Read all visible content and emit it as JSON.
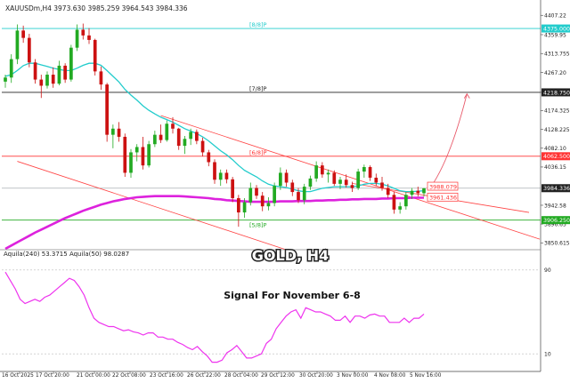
{
  "header": {
    "symbol_line": "XAUUSDm,H4  3973.630  3985.259  3964.543  3984.336",
    "indicator_line": "Aquila(240) 53.3715  Aquila(50) 98.0287"
  },
  "overlay": {
    "title": "GOLD, H4",
    "subtitle": "Signal For November 6-8"
  },
  "colors": {
    "bull": "#22aa22",
    "bear": "#cc1111",
    "ma_fast": "#22cccc",
    "ma_slow": "#dd22dd",
    "channel": "#ff4444",
    "level_cyan": "#22cccc",
    "level_red": "#ff3333",
    "level_green": "#22aa22",
    "level_black": "#222222",
    "oscillator": "#ee33ee"
  },
  "chart_data": [
    {
      "type": "candlestick",
      "title": "GOLD, H4",
      "symbol": "XAUUSDm",
      "timeframe": "H4",
      "ohlc_header": {
        "open": 3973.63,
        "high": 3985.259,
        "low": 3964.543,
        "close": 3984.336
      },
      "y_ticks": [
        4407.22,
        4359.95,
        4313.755,
        4267.2,
        4218.75,
        4174.325,
        4128.225,
        4082.1,
        4036.15,
        3942.58,
        3896.65,
        3850.615
      ],
      "x_ticks": [
        "16 Oct 2025",
        "17 Oct 20:00",
        "21 Oct 00:00",
        "22 Oct 08:00",
        "23 Oct 16:00",
        "26 Oct 22:00",
        "28 Oct 04:00",
        "29 Oct 12:00",
        "30 Oct 20:00",
        "3 Nov 00:00",
        "4 Nov 08:00",
        "5 Nov 16:00"
      ],
      "ylim": [
        3836,
        4436
      ],
      "price_labels": [
        {
          "label": "4375.000",
          "value": 4375.0,
          "kind": "cyan"
        },
        {
          "label": "4218.750",
          "value": 4218.75,
          "kind": "black"
        },
        {
          "label": "4062.500",
          "value": 4062.5,
          "kind": "red"
        },
        {
          "label": "3988.079",
          "value": 3988.079,
          "kind": "red-box"
        },
        {
          "label": "3984.336",
          "value": 3984.336,
          "kind": "current"
        },
        {
          "label": "3961.436",
          "value": 3961.436,
          "kind": "red-box"
        },
        {
          "label": "3906.250",
          "value": 3906.25,
          "kind": "green"
        }
      ],
      "levels": [
        {
          "label": "[8/8]P",
          "value": 4375.0,
          "kind": "cyan"
        },
        {
          "label": "[7/8]P",
          "value": 4218.75,
          "kind": "black"
        },
        {
          "label": "[6/8]P",
          "value": 4062.5,
          "kind": "red"
        },
        {
          "label": "[5/8]P",
          "value": 3906.25,
          "kind": "green"
        }
      ],
      "candles": [
        {
          "o": 4245,
          "h": 4262,
          "l": 4230,
          "c": 4255
        },
        {
          "o": 4255,
          "h": 4312,
          "l": 4242,
          "c": 4300
        },
        {
          "o": 4300,
          "h": 4385,
          "l": 4288,
          "c": 4370
        },
        {
          "o": 4370,
          "h": 4382,
          "l": 4340,
          "c": 4352
        },
        {
          "o": 4352,
          "h": 4362,
          "l": 4280,
          "c": 4292
        },
        {
          "o": 4292,
          "h": 4300,
          "l": 4240,
          "c": 4250
        },
        {
          "o": 4250,
          "h": 4262,
          "l": 4205,
          "c": 4235
        },
        {
          "o": 4235,
          "h": 4270,
          "l": 4228,
          "c": 4262
        },
        {
          "o": 4262,
          "h": 4280,
          "l": 4230,
          "c": 4240
        },
        {
          "o": 4240,
          "h": 4296,
          "l": 4236,
          "c": 4284
        },
        {
          "o": 4284,
          "h": 4290,
          "l": 4242,
          "c": 4250
        },
        {
          "o": 4250,
          "h": 4335,
          "l": 4245,
          "c": 4328
        },
        {
          "o": 4328,
          "h": 4385,
          "l": 4320,
          "c": 4372
        },
        {
          "o": 4372,
          "h": 4387,
          "l": 4348,
          "c": 4358
        },
        {
          "o": 4358,
          "h": 4376,
          "l": 4337,
          "c": 4347
        },
        {
          "o": 4347,
          "h": 4350,
          "l": 4260,
          "c": 4270
        },
        {
          "o": 4270,
          "h": 4282,
          "l": 4225,
          "c": 4238
        },
        {
          "o": 4238,
          "h": 4242,
          "l": 4098,
          "c": 4115
        },
        {
          "o": 4115,
          "h": 4140,
          "l": 4082,
          "c": 4130
        },
        {
          "o": 4130,
          "h": 4146,
          "l": 4098,
          "c": 4110
        },
        {
          "o": 4110,
          "h": 4118,
          "l": 4012,
          "c": 4022
        },
        {
          "o": 4022,
          "h": 4080,
          "l": 4010,
          "c": 4072
        },
        {
          "o": 4072,
          "h": 4092,
          "l": 4050,
          "c": 4085
        },
        {
          "o": 4085,
          "h": 4110,
          "l": 4030,
          "c": 4040
        },
        {
          "o": 4040,
          "h": 4100,
          "l": 4035,
          "c": 4092
        },
        {
          "o": 4092,
          "h": 4125,
          "l": 4085,
          "c": 4115
        },
        {
          "o": 4115,
          "h": 4140,
          "l": 4095,
          "c": 4102
        },
        {
          "o": 4102,
          "h": 4150,
          "l": 4098,
          "c": 4142
        },
        {
          "o": 4142,
          "h": 4158,
          "l": 4118,
          "c": 4130
        },
        {
          "o": 4130,
          "h": 4132,
          "l": 4078,
          "c": 4088
        },
        {
          "o": 4088,
          "h": 4112,
          "l": 4068,
          "c": 4105
        },
        {
          "o": 4105,
          "h": 4130,
          "l": 4090,
          "c": 4122
        },
        {
          "o": 4122,
          "h": 4128,
          "l": 4092,
          "c": 4100
        },
        {
          "o": 4100,
          "h": 4108,
          "l": 4062,
          "c": 4072
        },
        {
          "o": 4072,
          "h": 4078,
          "l": 4038,
          "c": 4048
        },
        {
          "o": 4048,
          "h": 4055,
          "l": 3995,
          "c": 4005
        },
        {
          "o": 4005,
          "h": 4030,
          "l": 3990,
          "c": 4022
        },
        {
          "o": 4022,
          "h": 4030,
          "l": 3996,
          "c": 4006
        },
        {
          "o": 4006,
          "h": 4012,
          "l": 3950,
          "c": 3960
        },
        {
          "o": 3960,
          "h": 3968,
          "l": 3890,
          "c": 3925
        },
        {
          "o": 3925,
          "h": 3960,
          "l": 3912,
          "c": 3950
        },
        {
          "o": 3950,
          "h": 3998,
          "l": 3942,
          "c": 3985
        },
        {
          "o": 3985,
          "h": 3992,
          "l": 3958,
          "c": 3966
        },
        {
          "o": 3966,
          "h": 3975,
          "l": 3928,
          "c": 3940
        },
        {
          "o": 3940,
          "h": 3962,
          "l": 3930,
          "c": 3948
        },
        {
          "o": 3948,
          "h": 3998,
          "l": 3940,
          "c": 3990
        },
        {
          "o": 3990,
          "h": 4035,
          "l": 3980,
          "c": 4022
        },
        {
          "o": 4022,
          "h": 4030,
          "l": 3988,
          "c": 3998
        },
        {
          "o": 3998,
          "h": 4005,
          "l": 3965,
          "c": 3975
        },
        {
          "o": 3975,
          "h": 3985,
          "l": 3948,
          "c": 3955
        },
        {
          "o": 3955,
          "h": 3995,
          "l": 3945,
          "c": 3988
        },
        {
          "o": 3988,
          "h": 4015,
          "l": 3980,
          "c": 4008
        },
        {
          "o": 4008,
          "h": 4050,
          "l": 4000,
          "c": 4040
        },
        {
          "o": 4040,
          "h": 4048,
          "l": 4010,
          "c": 4018
        },
        {
          "o": 4018,
          "h": 4030,
          "l": 3998,
          "c": 4022
        },
        {
          "o": 4022,
          "h": 4028,
          "l": 3990,
          "c": 3995
        },
        {
          "o": 3995,
          "h": 4012,
          "l": 3982,
          "c": 4005
        },
        {
          "o": 4005,
          "h": 4018,
          "l": 3986,
          "c": 3992
        },
        {
          "o": 3992,
          "h": 4000,
          "l": 3975,
          "c": 3985
        },
        {
          "o": 3985,
          "h": 4032,
          "l": 3980,
          "c": 4025
        },
        {
          "o": 4025,
          "h": 4042,
          "l": 4010,
          "c": 4036
        },
        {
          "o": 4036,
          "h": 4040,
          "l": 4002,
          "c": 4010
        },
        {
          "o": 4010,
          "h": 4020,
          "l": 3990,
          "c": 3998
        },
        {
          "o": 3998,
          "h": 4012,
          "l": 3978,
          "c": 3985
        },
        {
          "o": 3985,
          "h": 3995,
          "l": 3960,
          "c": 3968
        },
        {
          "o": 3968,
          "h": 3975,
          "l": 3922,
          "c": 3932
        },
        {
          "o": 3932,
          "h": 3950,
          "l": 3922,
          "c": 3940
        },
        {
          "o": 3940,
          "h": 3975,
          "l": 3932,
          "c": 3968
        },
        {
          "o": 3968,
          "h": 3985,
          "l": 3958,
          "c": 3978
        },
        {
          "o": 3978,
          "h": 3988,
          "l": 3964,
          "c": 3972
        },
        {
          "o": 3972,
          "h": 3985,
          "l": 3964,
          "c": 3984
        }
      ],
      "ma_fast": [
        4258,
        4262,
        4272,
        4284,
        4290,
        4290,
        4286,
        4282,
        4278,
        4275,
        4272,
        4272,
        4278,
        4285,
        4290,
        4290,
        4285,
        4272,
        4258,
        4244,
        4226,
        4212,
        4200,
        4186,
        4175,
        4166,
        4158,
        4152,
        4146,
        4138,
        4130,
        4124,
        4118,
        4110,
        4100,
        4088,
        4076,
        4066,
        4054,
        4040,
        4028,
        4020,
        4012,
        4002,
        3994,
        3990,
        3988,
        3986,
        3982,
        3978,
        3976,
        3976,
        3980,
        3984,
        3986,
        3988,
        3988,
        3988,
        3988,
        3990,
        3994,
        3996,
        3996,
        3994,
        3990,
        3984,
        3978,
        3976,
        3976,
        3977,
        3978
      ],
      "ma_slow": [
        3836,
        3844,
        3852,
        3860,
        3868,
        3876,
        3883,
        3890,
        3897,
        3904,
        3911,
        3917,
        3923,
        3929,
        3934,
        3939,
        3944,
        3948,
        3952,
        3955,
        3958,
        3960,
        3962,
        3963,
        3964,
        3965,
        3965,
        3965,
        3965,
        3965,
        3964,
        3963,
        3962,
        3961,
        3960,
        3958,
        3957,
        3955,
        3954,
        3953,
        3952,
        3951,
        3951,
        3951,
        3951,
        3951,
        3952,
        3952,
        3952,
        3953,
        3953,
        3953,
        3954,
        3954,
        3955,
        3955,
        3956,
        3956,
        3957,
        3957,
        3958,
        3958,
        3958,
        3959,
        3959,
        3960,
        3960,
        3960,
        3961,
        3961,
        3961
      ],
      "channel_upper": [
        [
          26,
          4162
        ],
        [
          70,
          3952
        ]
      ],
      "channel_lower": [
        [
          2,
          4050
        ],
        [
          44,
          3848
        ]
      ],
      "forecast_arrow": [
        [
          70,
          3988
        ],
        [
          76,
          4215
        ]
      ]
    },
    {
      "type": "line",
      "name": "Aquila oscillator",
      "title": "Aquila(240) 53.3715  Aquila(50) 98.0287",
      "y_ticks": [
        90,
        10
      ],
      "ylim": [
        0,
        100
      ],
      "values": [
        88,
        80,
        72,
        62,
        58,
        60,
        62,
        60,
        64,
        66,
        70,
        74,
        78,
        82,
        80,
        74,
        66,
        54,
        44,
        40,
        38,
        36,
        36,
        34,
        32,
        33,
        31,
        30,
        28,
        30,
        30,
        26,
        26,
        24,
        24,
        21,
        19,
        16,
        14,
        17,
        12,
        8,
        2,
        2,
        4,
        11,
        14,
        18,
        12,
        6,
        6,
        8,
        10,
        20,
        24,
        34,
        40,
        46,
        50,
        52,
        44,
        54,
        52,
        50,
        50,
        48,
        46,
        42,
        42,
        46,
        40,
        46,
        46,
        44,
        47,
        48,
        46,
        46,
        40,
        40,
        40,
        44,
        40,
        44,
        44,
        48
      ]
    }
  ]
}
